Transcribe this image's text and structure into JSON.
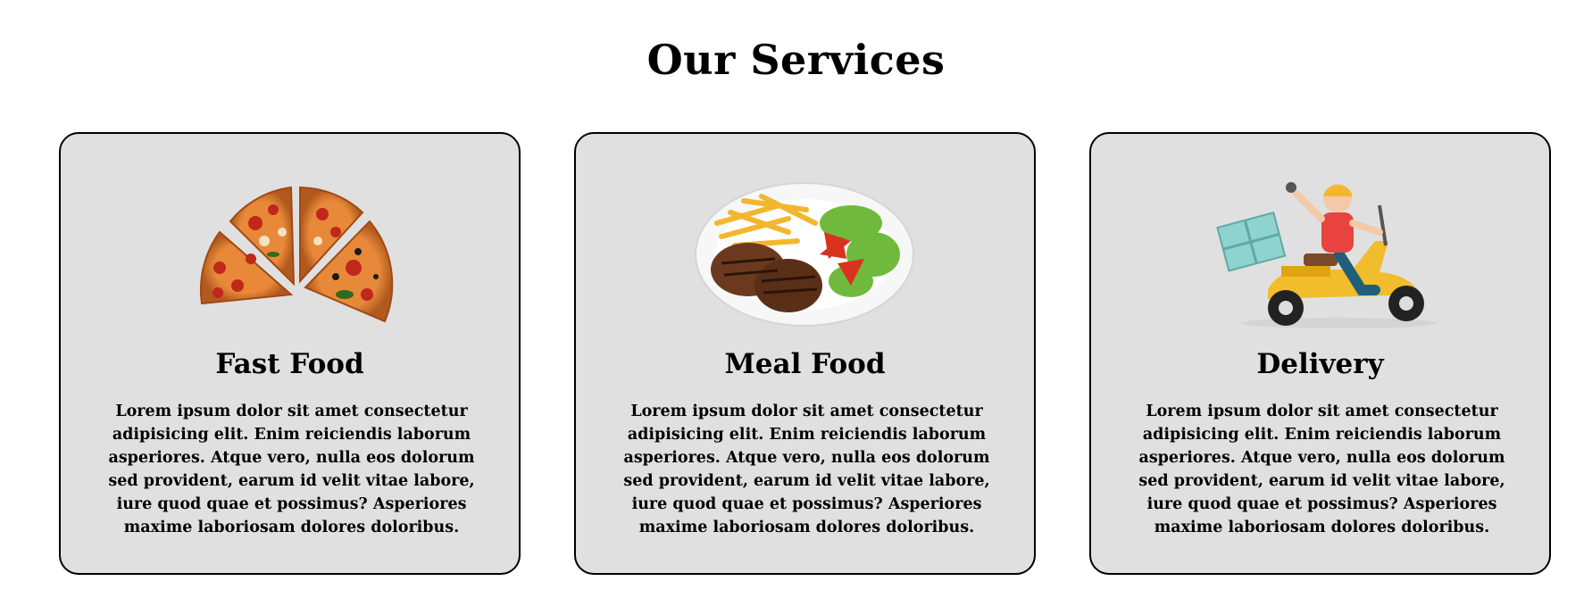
{
  "section": {
    "title": "Our Services"
  },
  "services": [
    {
      "title": "Fast Food",
      "image": "pizza-image",
      "text": "Lorem ipsum dolor sit amet consectetur adipisicing elit. Enim reiciendis laborum asperiores. Atque vero, nulla eos dolorum sed provident, earum id velit vitae labore, iure quod quae et possimus? Asperiores maxime laboriosam dolores doloribus."
    },
    {
      "title": "Meal Food",
      "image": "meal-plate-image",
      "text": "Lorem ipsum dolor sit amet consectetur adipisicing elit. Enim reiciendis laborum asperiores. Atque vero, nulla eos dolorum sed provident, earum id velit vitae labore, iure quod quae et possimus? Asperiores maxime laboriosam dolores doloribus."
    },
    {
      "title": "Delivery",
      "image": "delivery-scooter-image",
      "text": "Lorem ipsum dolor sit amet consectetur adipisicing elit. Enim reiciendis laborum asperiores. Atque vero, nulla eos dolorum sed provident, earum id velit vitae labore, iure quod quae et possimus? Asperiores maxime laboriosam dolores doloribus."
    }
  ],
  "colors": {
    "card_background": "#e0e0e0",
    "card_border": "#000000",
    "text": "#000000"
  }
}
